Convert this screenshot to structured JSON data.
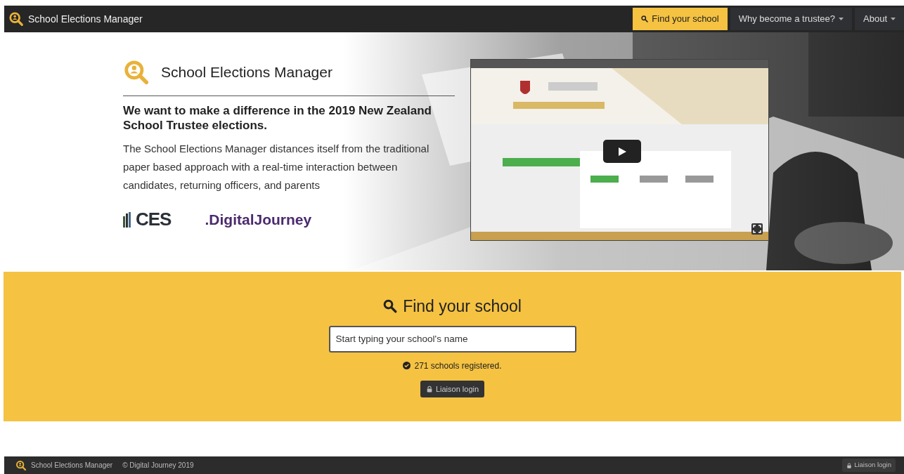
{
  "navbar": {
    "brand": "School Elections Manager",
    "links": [
      {
        "label": "Find your school",
        "selected": true,
        "dropdown": false
      },
      {
        "label": "Why become a trustee?",
        "selected": false,
        "dropdown": true
      },
      {
        "label": "About",
        "selected": false,
        "dropdown": true
      }
    ]
  },
  "hero": {
    "title": "School Elections Manager",
    "headline": "We want to make a difference in the 2019 New Zealand School Trustee elections.",
    "description": "The School Elections Manager distances itself from the traditional paper based approach with a real-time interaction between candidates, returning officers, and parents",
    "partners": [
      "CES",
      ".DigitalJourney"
    ],
    "video": {
      "kind": "picture"
    }
  },
  "search": {
    "heading": "Find your school",
    "placeholder": "Start typing your school's name",
    "count": "271 schools registered.",
    "login_button": "Liaison login"
  },
  "footer": {
    "brand": "School Elections Manager",
    "copyright": "© Digital Journey 2019",
    "login_button": "Liaison login"
  }
}
